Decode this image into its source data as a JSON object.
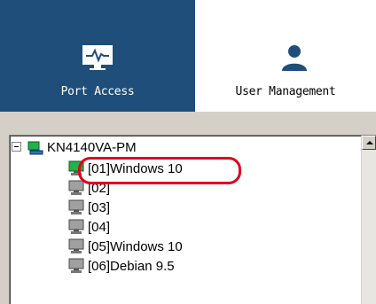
{
  "tabs": {
    "port_access": {
      "label": "Port Access",
      "icon": "monitor-pulse-icon"
    },
    "user_management": {
      "label": "User Management",
      "icon": "user-icon"
    }
  },
  "colors": {
    "active_tab": "#1f4e7a",
    "online_port": "#22b14c",
    "highlight": "#e0001a"
  },
  "tree": {
    "root": {
      "label": "KN4140VA-PM",
      "expanded": true
    },
    "ports": [
      {
        "label": "[01]Windows 10",
        "online": true,
        "highlighted": true
      },
      {
        "label": "[02]",
        "online": false
      },
      {
        "label": "[03]",
        "online": false
      },
      {
        "label": "[04]",
        "online": false
      },
      {
        "label": "[05]Windows 10",
        "online": false
      },
      {
        "label": "[06]Debian 9.5",
        "online": false
      }
    ]
  }
}
